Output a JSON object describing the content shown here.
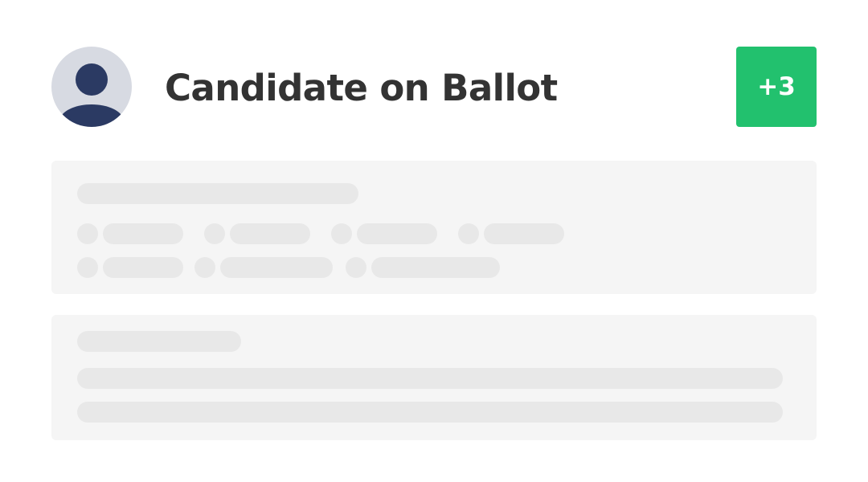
{
  "candidate": {
    "name": "Candidate on Ballot",
    "avatar_icon": "user-avatar-icon"
  },
  "badge": {
    "label": "+3",
    "color": "#22c16e"
  },
  "colors": {
    "avatar_background": "#d7dae2",
    "avatar_figure": "#2b3a63",
    "card_background": "#f5f5f5",
    "skeleton": "#e8e8e8",
    "title_text": "#333333"
  }
}
